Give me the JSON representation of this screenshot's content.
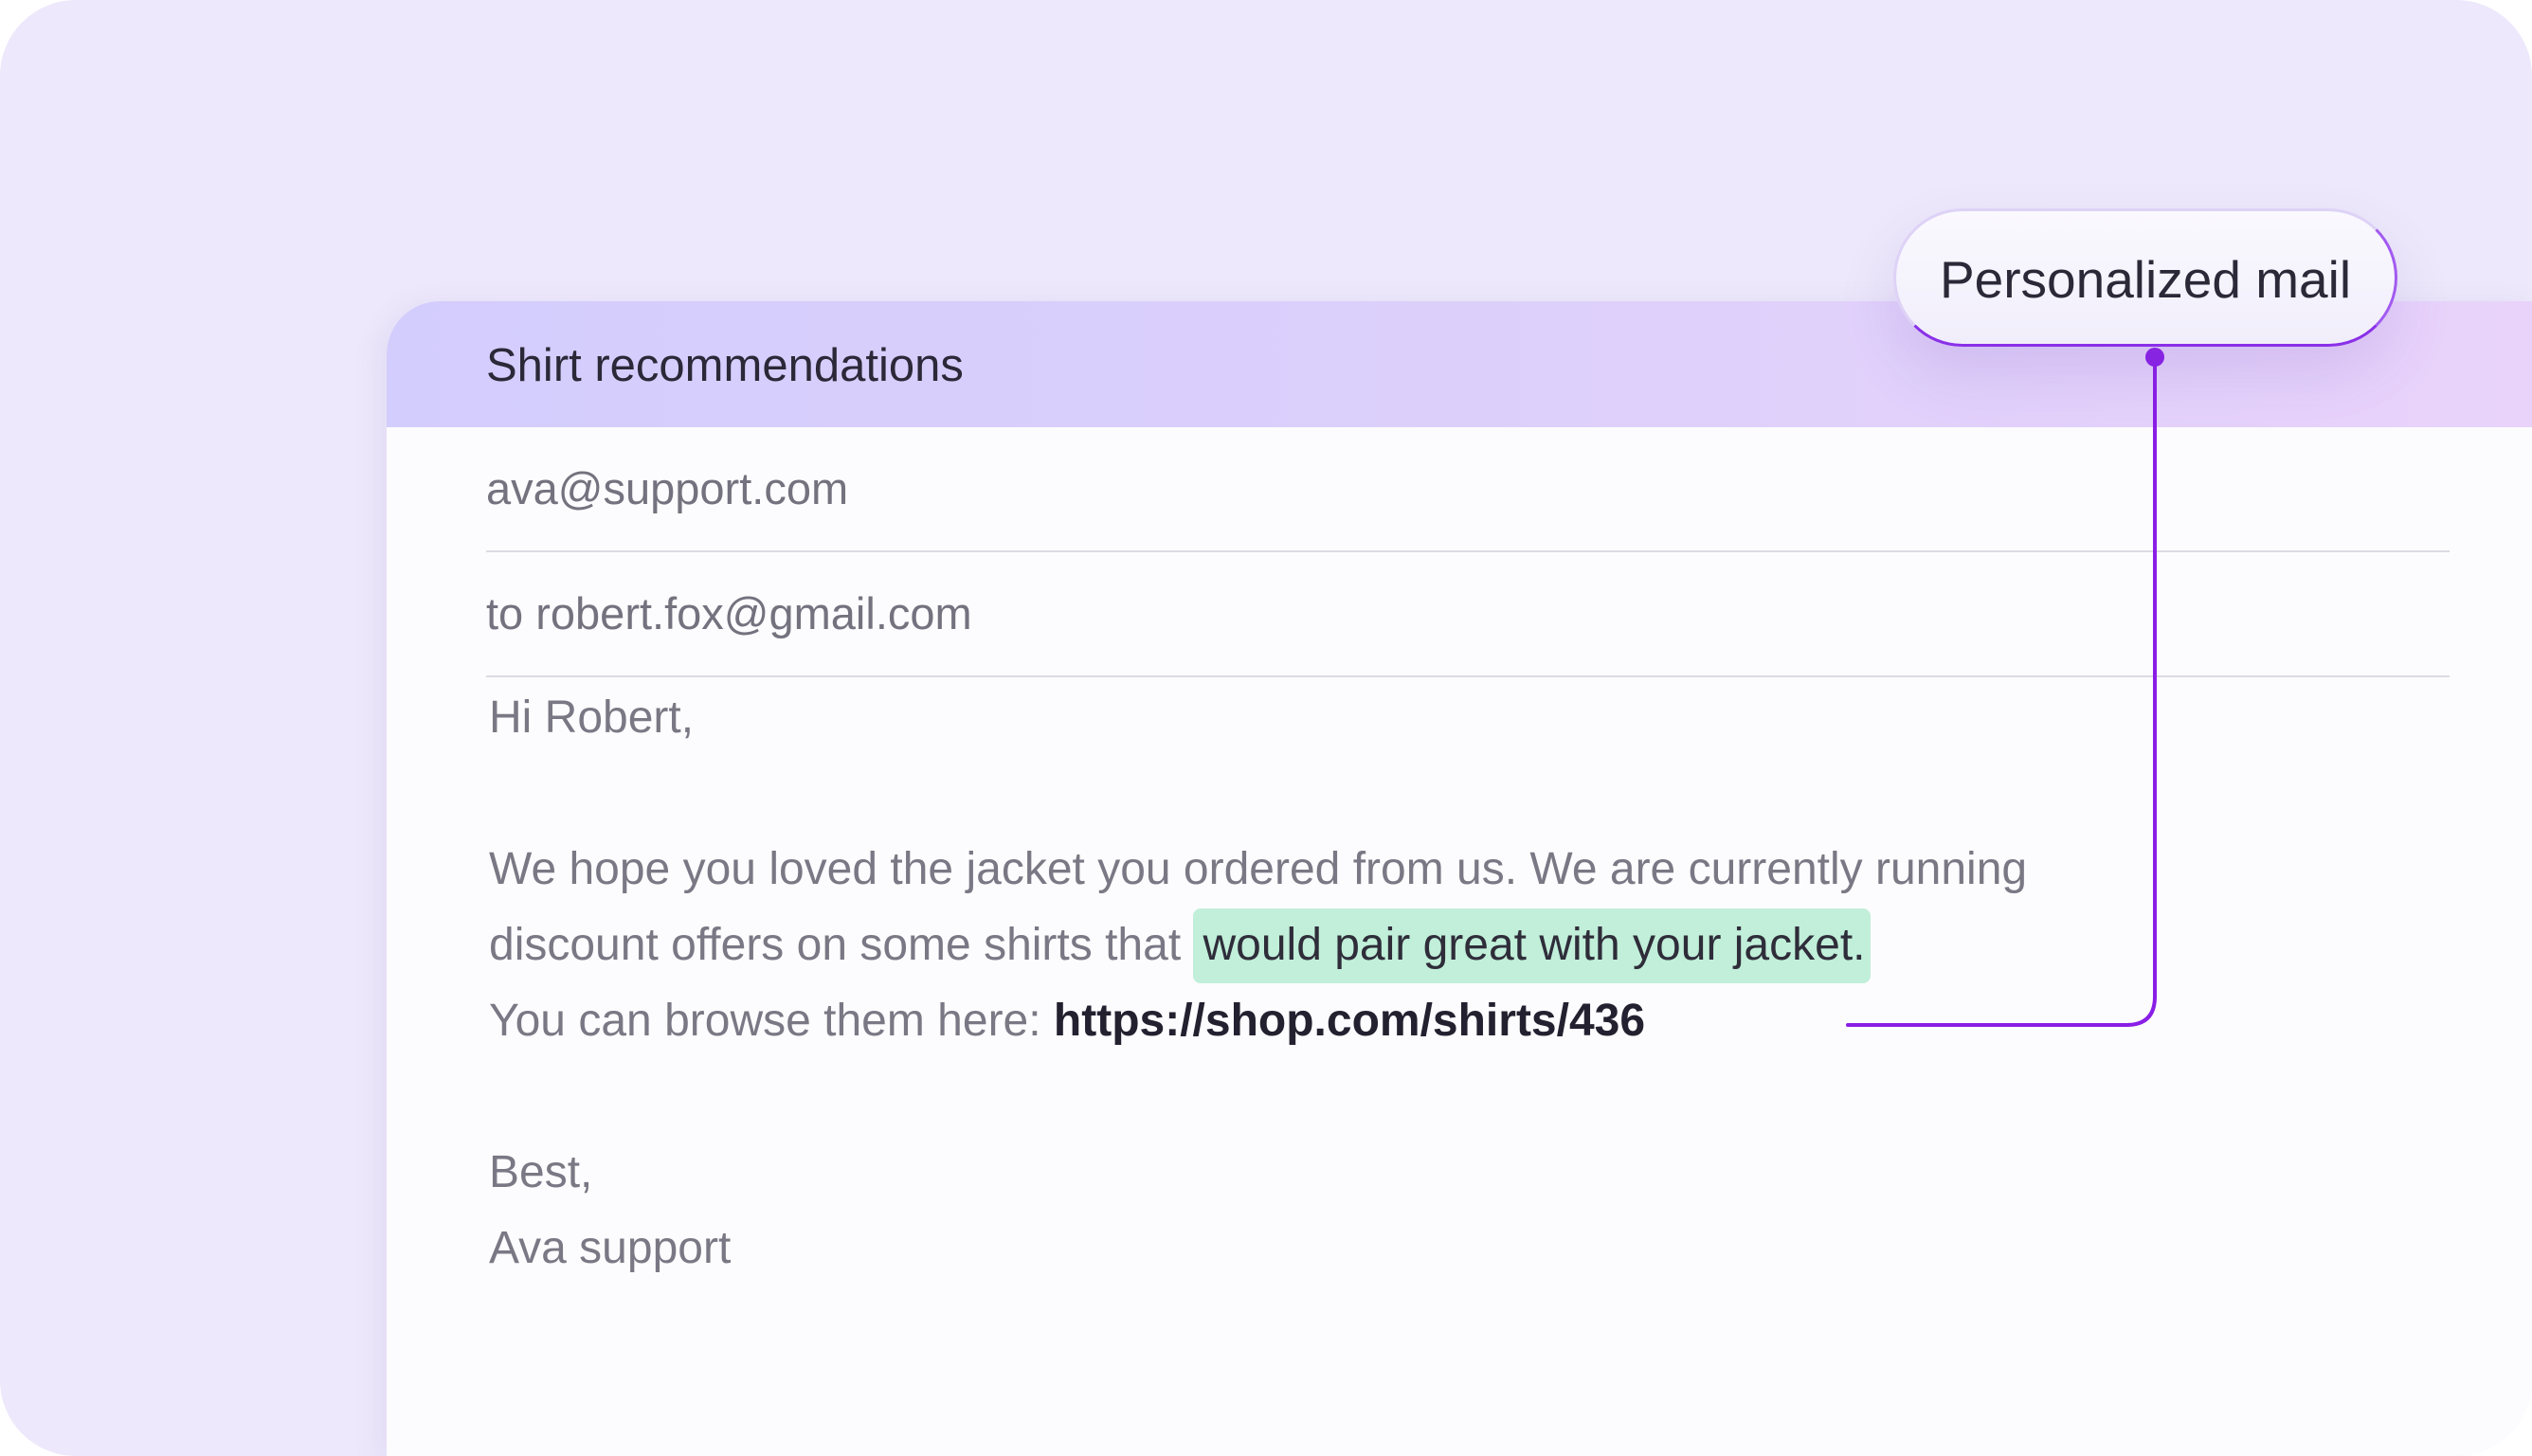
{
  "badge": {
    "label": "Personalized mail"
  },
  "email": {
    "subject": "Shirt recommendations",
    "from": "ava@support.com",
    "to": "to robert.fox@gmail.com",
    "body": {
      "greeting": "Hi Robert,",
      "line1": "We hope you loved the jacket you ordered from us. We are currently running",
      "line2_prefix": "discount offers on some shirts that ",
      "line2_highlight": "would pair great with your jacket.",
      "line3_prefix": "You can browse them here: ",
      "link": "https://shop.com/shirts/436",
      "signoff": "Best,",
      "signature": "Ava support"
    }
  },
  "colors": {
    "background": "#ede8fb",
    "header_gradient_start": "#d3cdfd",
    "header_gradient_end": "#e9d3fb",
    "highlight": "#c1efd9",
    "connector": "#8a1ee6"
  }
}
